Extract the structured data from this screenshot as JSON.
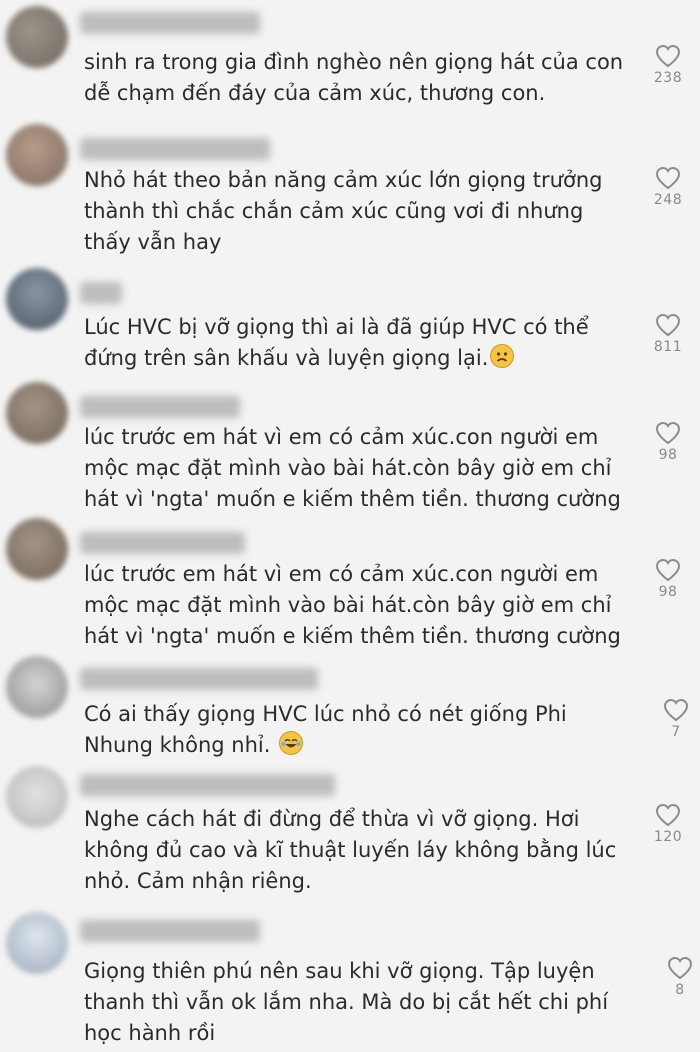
{
  "comments": [
    {
      "text": "sinh ra trong gia đình nghèo nên giọng hát của con dễ chạm đến đáy của cảm xúc, thương con.",
      "likes": "238"
    },
    {
      "text": "Nhỏ hát theo bản năng cảm xúc lớn giọng trưởng thành thì chắc chắn cảm xúc cũng vơi đi nhưng thấy vẫn hay",
      "likes": "248"
    },
    {
      "text": "Lúc HVC bị vỡ giọng thì ai là đã giúp HVC có thể đứng trên sân khấu và luyện giọng lại.",
      "likes": "811",
      "emoji": "sad-face-emoji"
    },
    {
      "text": "lúc trước em hát vì em có cảm xúc.con người em mộc mạc đặt mình vào bài hát.còn bây giờ em chỉ hát vì 'ngta' muốn e kiếm thêm tiền. thương cường",
      "likes": "98"
    },
    {
      "text": "lúc trước em hát vì em có cảm xúc.con người em mộc mạc đặt mình vào bài hát.còn bây giờ em chỉ hát vì 'ngta' muốn e kiếm thêm tiền. thương cường",
      "likes": "98"
    },
    {
      "text": "Có ai thấy giọng HVC lúc nhỏ có nét giống Phi Nhung không nhỉ.",
      "likes": "7",
      "emoji": "laughing-tears-emoji"
    },
    {
      "text": "Nghe cách hát đi đừng để thừa vì vỡ giọng. Hơi không đủ cao và kĩ thuật luyến láy không bằng lúc nhỏ. Cảm nhận riêng.",
      "likes": "120"
    },
    {
      "text": "Giọng thiên phú nên sau khi vỡ giọng. Tập luyện thanh thì vẫn ok lắm nha. Mà do bị cắt hết chi phí học hành rồi",
      "likes": "8"
    }
  ],
  "icons": {
    "like": "heart-outline-icon"
  },
  "colors": {
    "background": "#f3f3f3",
    "text": "#2b2b2b",
    "count": "#8a8a8a",
    "heart": "#8c8c8c"
  }
}
